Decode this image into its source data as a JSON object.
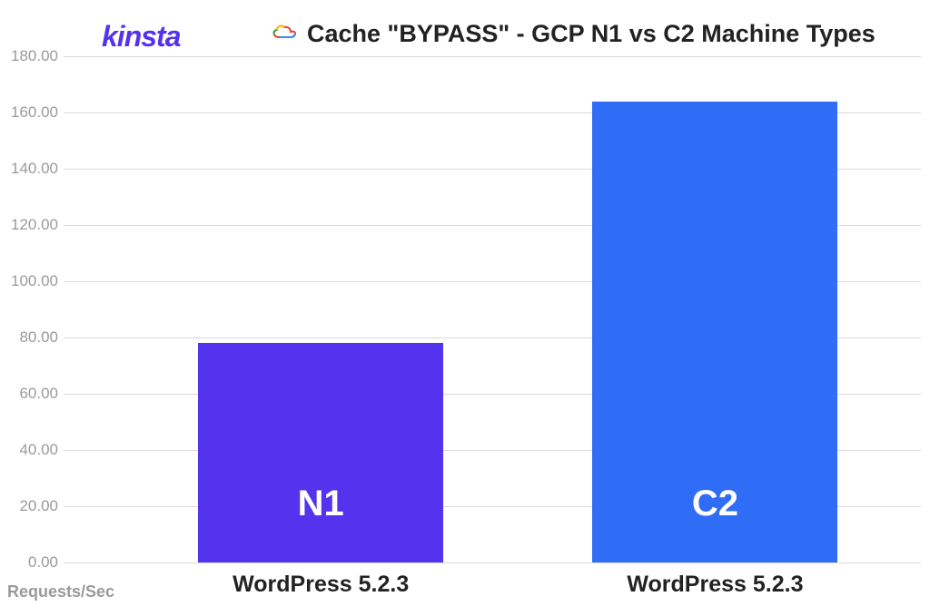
{
  "brand": "kinsta",
  "title": "Cache \"BYPASS\" - GCP N1 vs C2 Machine Types",
  "y_axis_label": "Requests/Sec",
  "chart_data": {
    "type": "bar",
    "categories": [
      "WordPress 5.2.3",
      "WordPress 5.2.3"
    ],
    "values": [
      78,
      164
    ],
    "bar_labels": [
      "N1",
      "C2"
    ],
    "colors": [
      "#5333ed",
      "#2f6df6"
    ],
    "ylim": [
      0,
      180
    ],
    "y_ticks": [
      "0.00",
      "20.00",
      "40.00",
      "60.00",
      "80.00",
      "100.00",
      "120.00",
      "140.00",
      "160.00",
      "180.00"
    ],
    "ylabel": "Requests/Sec",
    "title": "Cache \"BYPASS\" - GCP N1 vs C2 Machine Types"
  }
}
